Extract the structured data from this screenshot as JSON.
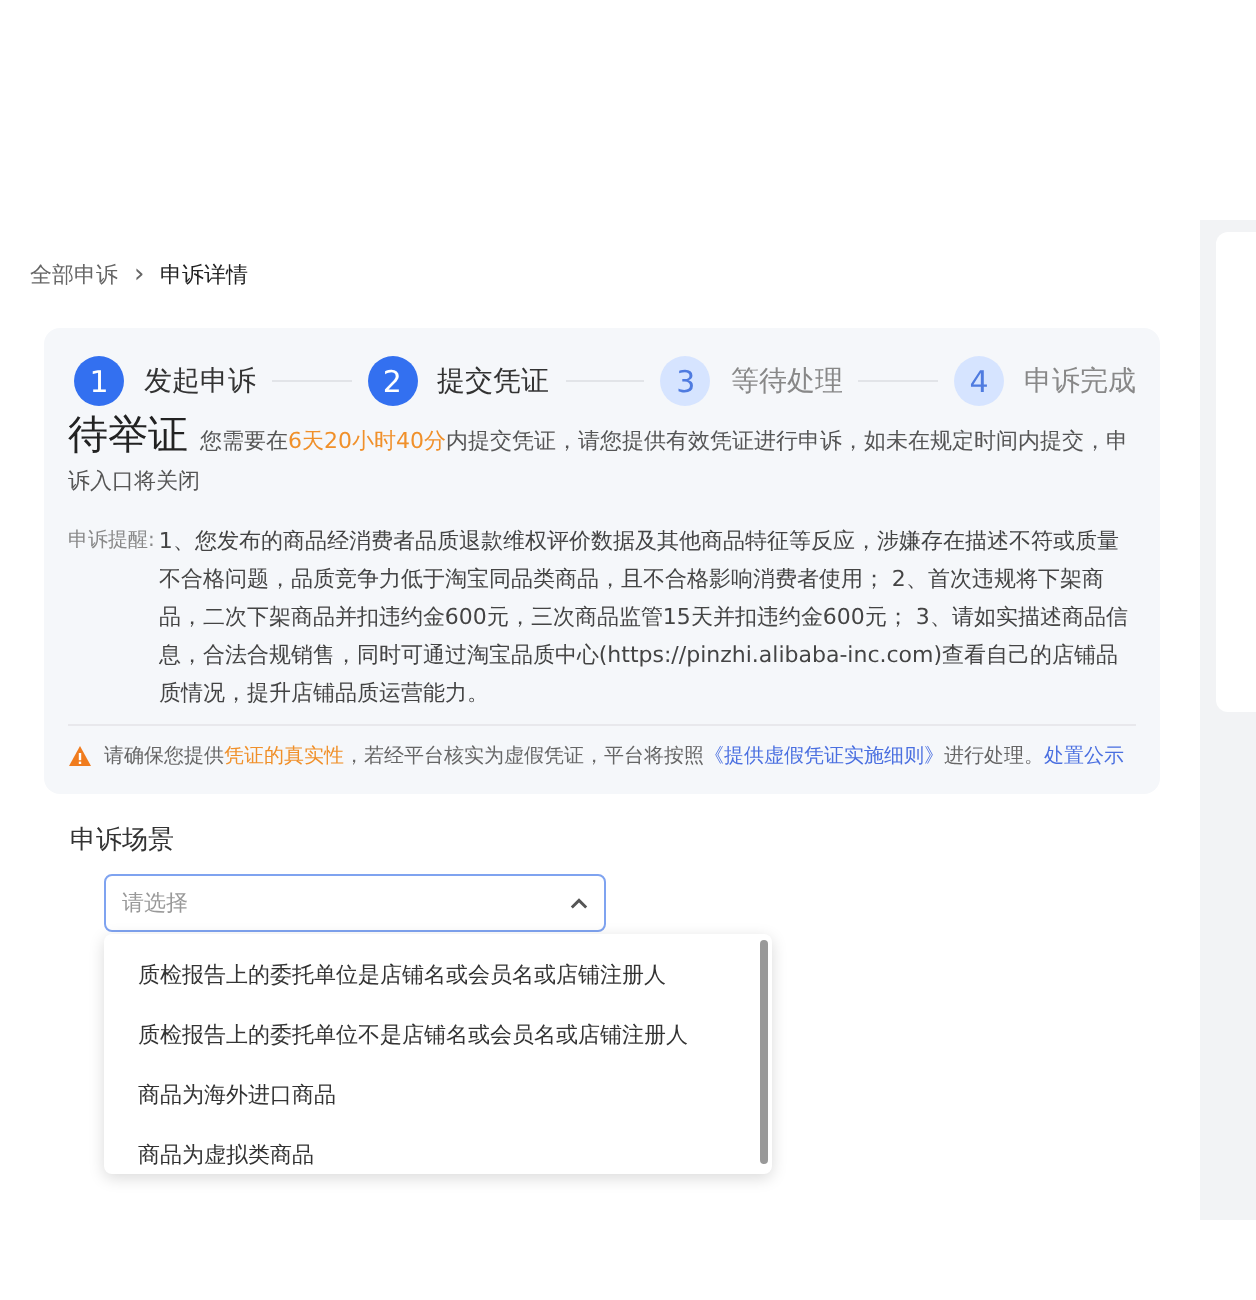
{
  "breadcrumb": [
    {
      "label": "全部申诉",
      "current": false
    },
    {
      "label": "申诉详情",
      "current": true
    }
  ],
  "breadcrumb_separator": "›",
  "steps": [
    {
      "number": "1",
      "label": "发起申诉",
      "active": true
    },
    {
      "number": "2",
      "label": "提交凭证",
      "active": true
    },
    {
      "number": "3",
      "label": "等待处理",
      "active": false
    },
    {
      "number": "4",
      "label": "申诉完成",
      "active": false
    }
  ],
  "status": {
    "title": "待举证",
    "message": [
      {
        "text": "您需要在",
        "highlight": false
      },
      {
        "text": "6天20小时40分",
        "highlight": true
      },
      {
        "text": "内提交凭证，请您提供有效凭证进行申诉，如未在规定时间内提交，申诉入口将关闭",
        "highlight": false
      }
    ]
  },
  "reminder": {
    "label": "申诉提醒:",
    "text": "1、您发布的商品经消费者品质退款维权评价数据及其他商品特征等反应，涉嫌存在描述不符或质量不合格问题，品质竞争力低于淘宝同品类商品，且不合格影响消费者使用； 2、首次违规将下架商品，二次下架商品并扣违约金600元，三次商品监管15天并扣违约金600元； 3、请如实描述商品信息，合法合规销售，同时可通过淘宝品质中心(https://pinzhi.alibaba-inc.com)查看自己的店铺品质情况，提升店铺品质运营能力。"
  },
  "warning": [
    {
      "kind": "text",
      "text": "请确保您提供"
    },
    {
      "kind": "highlight",
      "text": "凭证的真实性"
    },
    {
      "kind": "text",
      "text": "，若经平台核实为虚假凭证，平台将按照"
    },
    {
      "kind": "link",
      "text": "《提供虚假凭证实施细则》"
    },
    {
      "kind": "text",
      "text": "进行处理。"
    },
    {
      "kind": "link",
      "text": "处置公示"
    }
  ],
  "scene": {
    "label": "申诉场景",
    "placeholder": "请选择",
    "expanded": true,
    "options": [
      "质检报告上的委托单位是店铺名或会员名或店铺注册人",
      "质检报告上的委托单位不是店铺名或会员名或店铺注册人",
      "商品为海外进口商品",
      "商品为虚拟类商品"
    ]
  }
}
